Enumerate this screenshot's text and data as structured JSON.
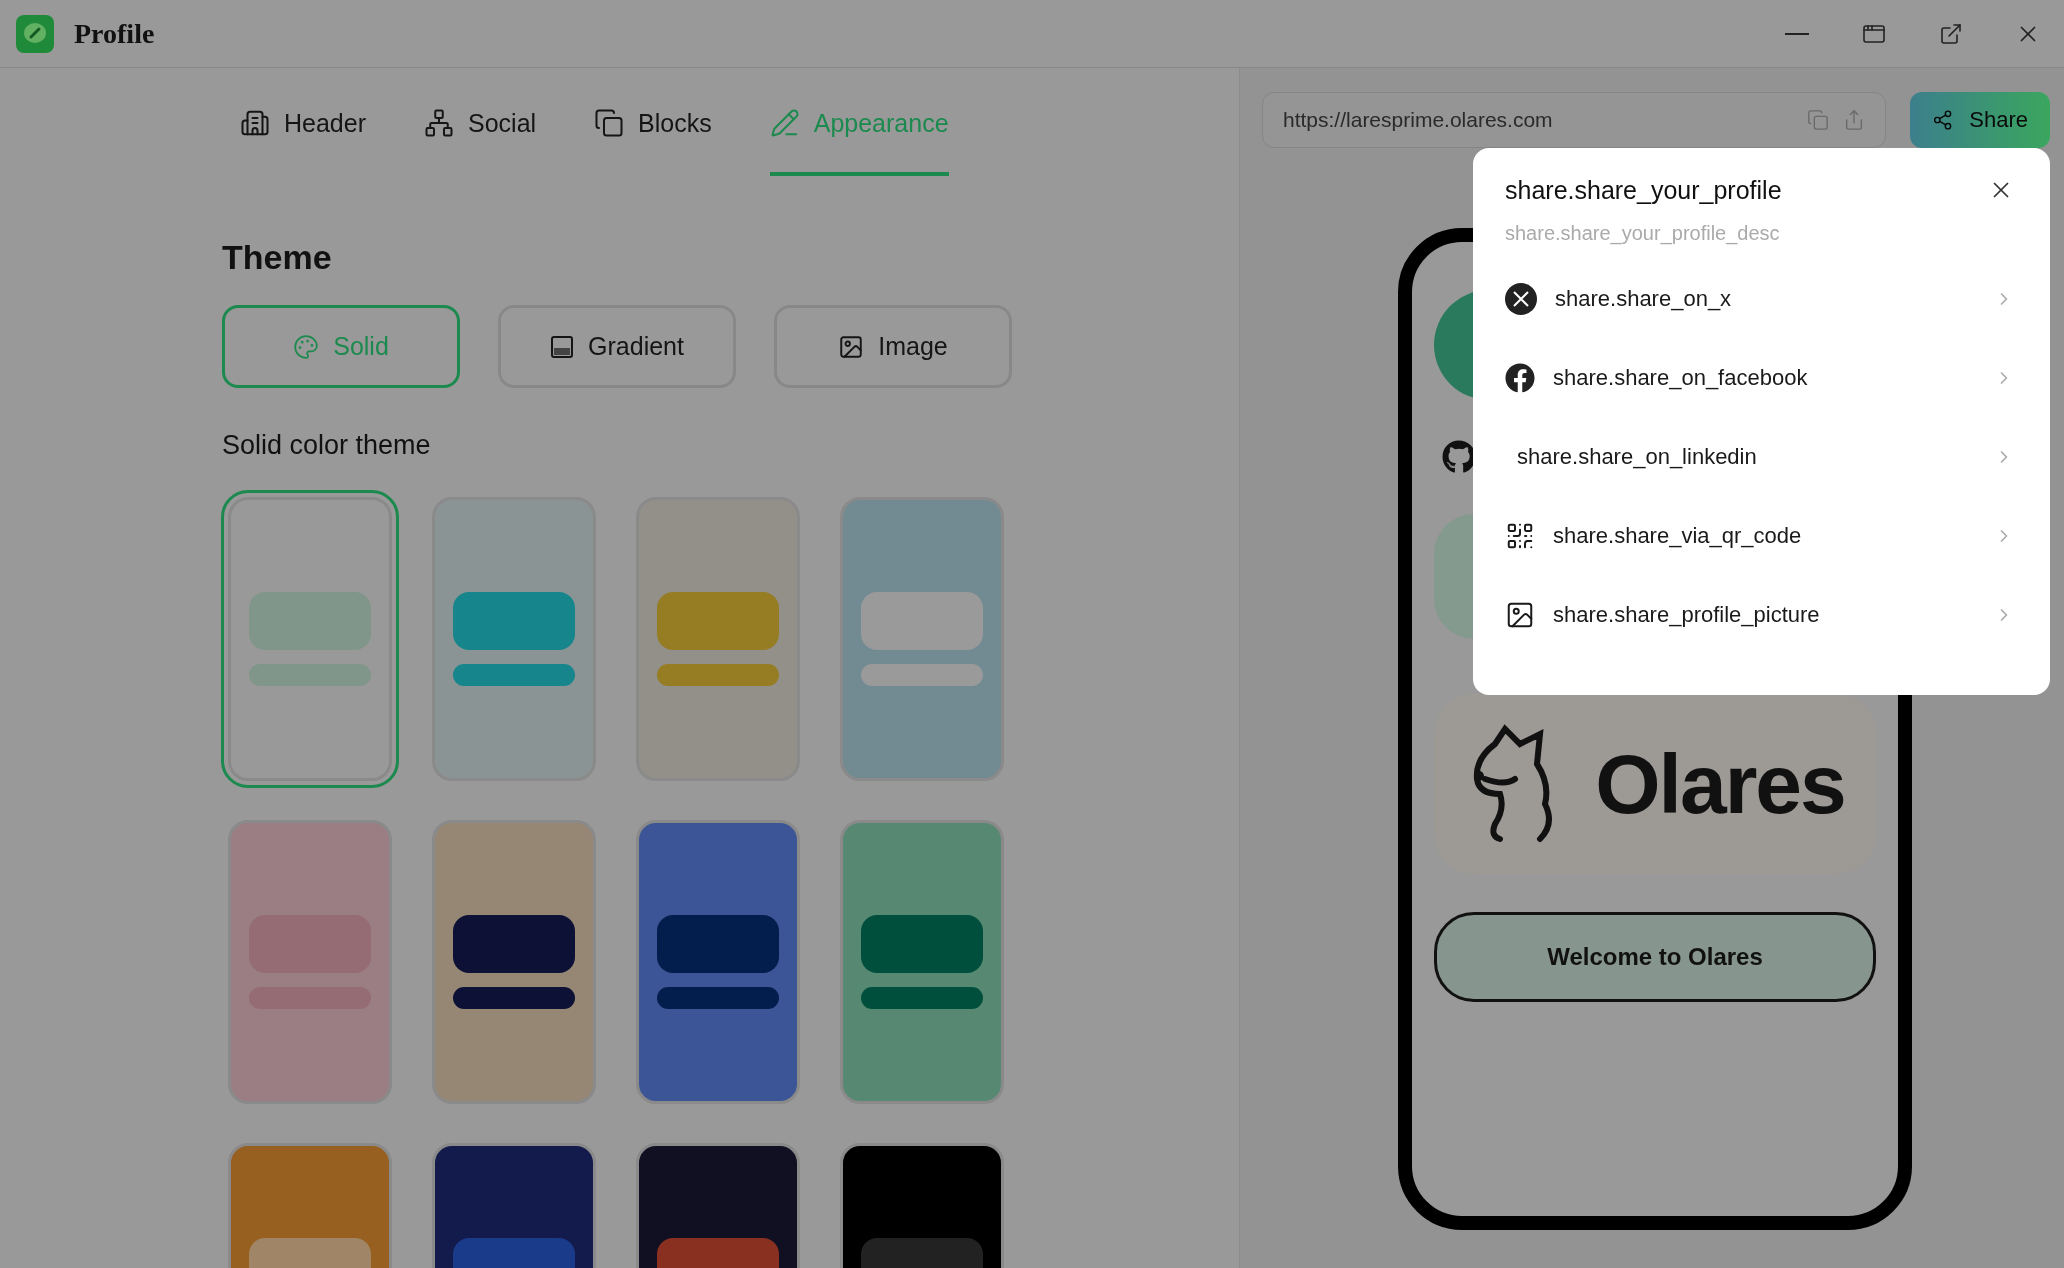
{
  "window": {
    "title": "Profile"
  },
  "tabs": [
    {
      "label": "Header",
      "selected": false
    },
    {
      "label": "Social",
      "selected": false
    },
    {
      "label": "Blocks",
      "selected": false
    },
    {
      "label": "Appearance",
      "selected": true
    }
  ],
  "theme": {
    "heading": "Theme",
    "options": [
      {
        "label": "Solid",
        "kind": "solid",
        "selected": true
      },
      {
        "label": "Gradient",
        "kind": "gradient",
        "selected": false
      },
      {
        "label": "Image",
        "kind": "image",
        "selected": false
      }
    ],
    "subheading": "Solid color theme",
    "swatches": [
      {
        "color": "#999999",
        "accent": {
          "color": "#81968a"
        },
        "selected": true
      },
      {
        "color": "#8a9494",
        "accent": {
          "color": "#16868c"
        },
        "selected": false
      },
      {
        "color": "#929089",
        "accent": {
          "color": "#967c23"
        },
        "selected": false
      },
      {
        "color": "#728b93",
        "accent": {
          "color": "#9a9a9a"
        },
        "selected": false
      },
      {
        "color": "#9a7e83",
        "accent": {
          "color": "#956b74"
        },
        "selected": false
      },
      {
        "color": "#968774",
        "accent": {
          "color": "#0c1135"
        },
        "selected": false
      },
      {
        "color": "#3c5597",
        "accent": {
          "color": "#031e4c"
        },
        "selected": false
      },
      {
        "color": "#578872",
        "accent": {
          "color": "#004f3c"
        },
        "selected": false
      },
      {
        "color": "#975f20",
        "accent": {
          "color": "#a08566"
        },
        "selected": false
      },
      {
        "color": "#131a4c",
        "accent": {
          "color": "#1a3a8a"
        },
        "selected": false
      },
      {
        "color": "#101022",
        "accent": {
          "color": "#8a3020"
        },
        "selected": false
      },
      {
        "color": "#000000",
        "accent": {
          "color": "#222222"
        },
        "selected": false
      }
    ]
  },
  "url_bar": {
    "value": "https://laresprime.olares.com"
  },
  "share_button": {
    "label": "Share"
  },
  "preview": {
    "logo_text": "Olares",
    "welcome_button": "Welcome to Olares"
  },
  "share_dialog": {
    "title": "share.share_your_profile",
    "description": "share.share_your_profile_desc",
    "items": [
      {
        "label": "share.share_on_x",
        "kind": "x"
      },
      {
        "label": "share.share_on_facebook",
        "kind": "facebook"
      },
      {
        "label": "share.share_on_linkedin",
        "kind": "linkedin"
      },
      {
        "label": "share.share_via_qr_code",
        "kind": "qr"
      },
      {
        "label": "share.share_profile_picture",
        "kind": "picture"
      }
    ]
  }
}
